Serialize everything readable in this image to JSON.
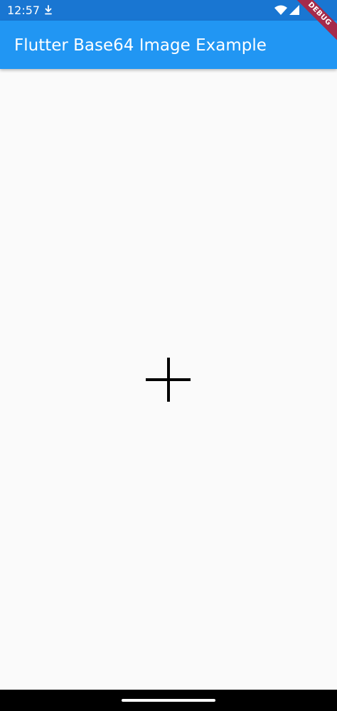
{
  "status_bar": {
    "time": "12:57",
    "icons": [
      "download-icon",
      "wifi-icon",
      "signal-icon"
    ],
    "color": "#1976d2"
  },
  "app_bar": {
    "title": "Flutter Base64 Image Example",
    "color": "#2196f3"
  },
  "debug_banner": {
    "label": "DEBUG",
    "color": "#a52a4a"
  },
  "content": {
    "center_icon": "plus-icon",
    "background": "#fafafa"
  },
  "nav_bar": {
    "color": "#000000"
  }
}
